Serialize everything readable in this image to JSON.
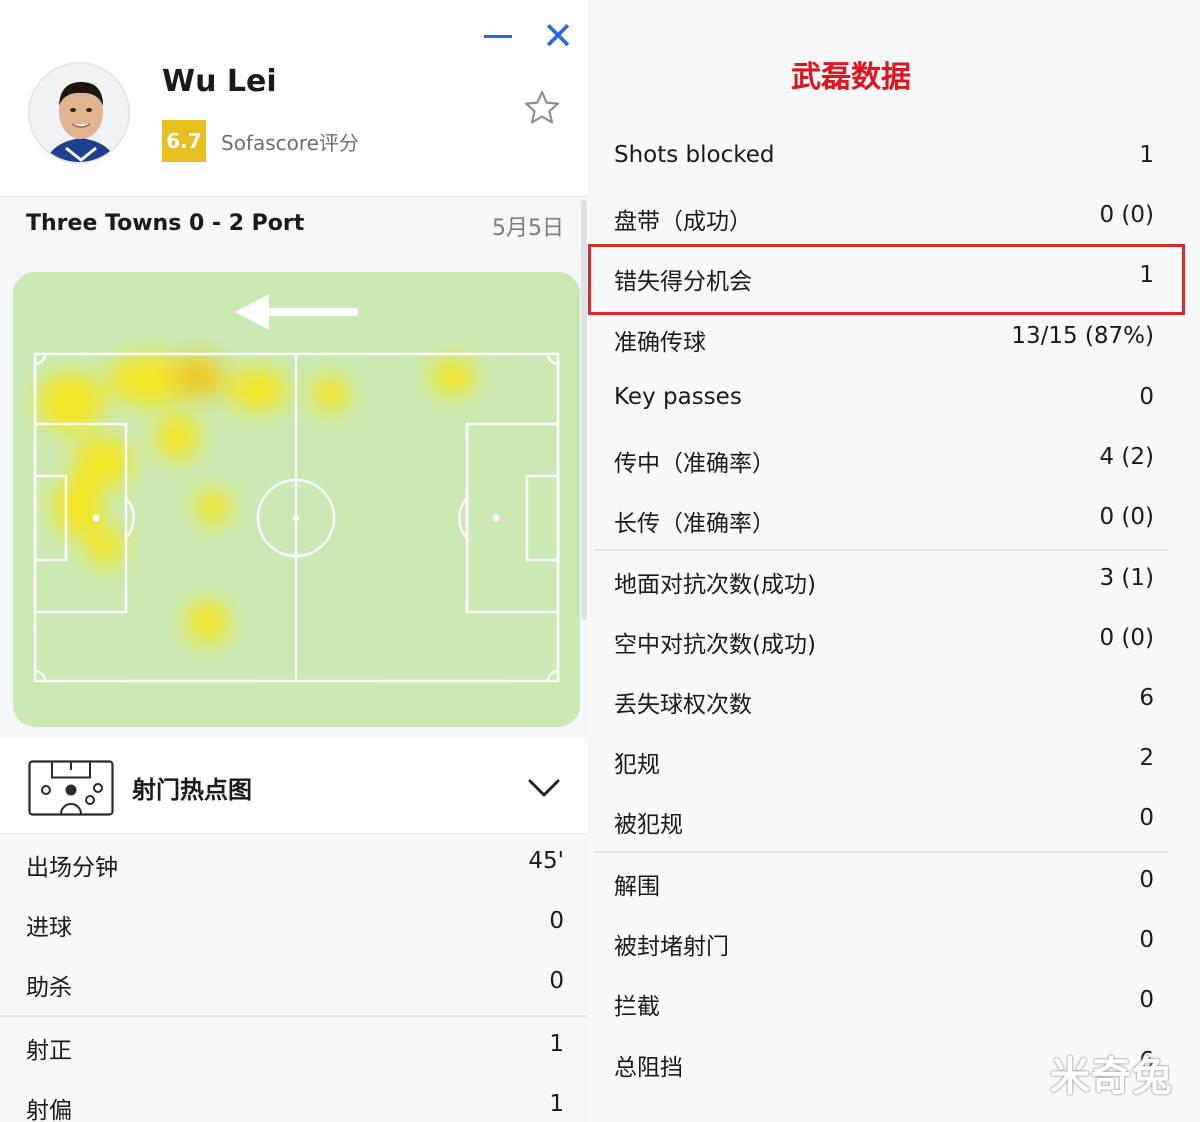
{
  "player": {
    "name": "Wu Lei",
    "rating": "6.7",
    "rating_label": "Sofascore评分"
  },
  "window": {
    "close_glyph": "✕"
  },
  "match": {
    "title": "Three Towns 0 - 2 Port",
    "date": "5月5日"
  },
  "shot_map": {
    "label": "射门热点图"
  },
  "left_stats": [
    {
      "label": "出场分钟",
      "value": "45'"
    },
    {
      "label": "进球",
      "value": "0"
    },
    {
      "label": "助杀",
      "value": "0"
    },
    {
      "label": "射正",
      "value": "1"
    },
    {
      "label": "射偏",
      "value": "1"
    }
  ],
  "right": {
    "title": "武磊数据",
    "stats": [
      {
        "label": "Shots blocked",
        "value": "1"
      },
      {
        "label": "盘带（成功）",
        "value": "0 (0)"
      },
      {
        "label": "错失得分机会",
        "value": "1"
      },
      {
        "label": "准确传球",
        "value": "13/15 (87%)"
      },
      {
        "label": "Key passes",
        "value": "0"
      },
      {
        "label": "传中（准确率）",
        "value": "4 (2)"
      },
      {
        "label": "长传（准确率）",
        "value": "0 (0)"
      },
      {
        "label": "地面对抗次数(成功)",
        "value": "3 (1)"
      },
      {
        "label": "空中对抗次数(成功)",
        "value": "0 (0)"
      },
      {
        "label": "丢失球权次数",
        "value": "6"
      },
      {
        "label": "犯规",
        "value": "2"
      },
      {
        "label": "被犯规",
        "value": "0"
      },
      {
        "label": "解围",
        "value": "0"
      },
      {
        "label": "被封堵射门",
        "value": "0"
      },
      {
        "label": "拦截",
        "value": "0"
      },
      {
        "label": "总阻挡",
        "value": "6"
      }
    ]
  },
  "watermark": "米奇兔",
  "colors": {
    "accent_blue": "#2c68d8",
    "rating_bg": "#e7c01f",
    "headline_red": "#e0141e",
    "highlight_border": "#d82a2a",
    "pitch_green": "#c9eab4",
    "heat_yellow": "#f7e616"
  }
}
